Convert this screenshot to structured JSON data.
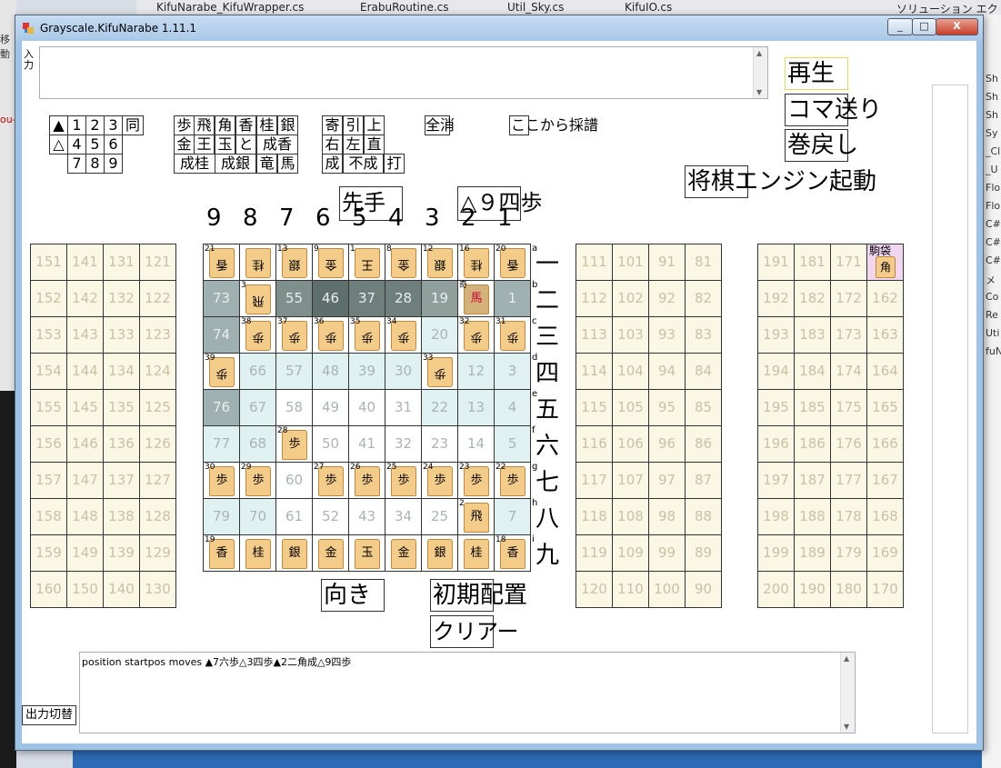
{
  "ide": {
    "tabs": [
      "KifuNarabe_KifuWrapper.cs",
      "ErabuRoutine.cs",
      "Util_Sky.cs",
      "KifuIO.cs",
      "ソリューション エク"
    ],
    "solution_items": [
      "Sh",
      "Sh",
      "Sh",
      "Sy",
      "_Cl",
      "_U",
      "Flo",
      "Flo",
      "C#",
      "C#",
      "C#",
      "メ",
      "Co",
      "Re",
      "Uti",
      "fuN"
    ],
    "left_fragments": [
      "移動",
      "ou-"
    ]
  },
  "window": {
    "title": "Grayscale.KifuNarabe 1.11.1",
    "minimize": "_",
    "maximize": "□",
    "close": "X"
  },
  "input": {
    "label": "入力",
    "value": ""
  },
  "number_buttons": [
    "▲",
    "1",
    "2",
    "3",
    "同",
    "△",
    "4",
    "5",
    "6",
    "7",
    "8",
    "9"
  ],
  "piece_buttons": [
    "歩",
    "飛",
    "角",
    "香",
    "桂",
    "銀",
    "金",
    "王",
    "玉",
    "と",
    "成香",
    "成桂",
    "成銀",
    "竜",
    "馬"
  ],
  "move_buttons": [
    "寄",
    "引",
    "上",
    "右",
    "左",
    "直",
    "成",
    "不成",
    "打"
  ],
  "clear_all": "全消",
  "record_from_here": "ここから採譜",
  "side_button": "先手",
  "last_move_label": "△９四歩",
  "right_buttons": {
    "play": "再生",
    "step_forward": "コマ送り",
    "rewind": "巻戻し",
    "engine": "将棋エンジン起動"
  },
  "column_numbers": [
    "9",
    "8",
    "7",
    "6",
    "5",
    "4",
    "3",
    "2",
    "1"
  ],
  "row_kanji": [
    "一",
    "二",
    "三",
    "四",
    "五",
    "六",
    "七",
    "八",
    "九"
  ],
  "row_letters": [
    "a",
    "b",
    "c",
    "d",
    "e",
    "f",
    "g",
    "h",
    "i"
  ],
  "board": [
    [
      "21",
      "",
      "13",
      "9",
      "1",
      "8",
      "12",
      "16",
      "20"
    ],
    [
      "73",
      "3",
      "55",
      "46",
      "37",
      "28",
      "19",
      "",
      "1"
    ],
    [
      "74",
      "",
      "",
      "",
      "",
      "",
      "20",
      "",
      "31"
    ],
    [
      "",
      "66",
      "57",
      "48",
      "39",
      "30",
      "",
      "12",
      "3"
    ],
    [
      "76",
      "67",
      "58",
      "49",
      "40",
      "31",
      "22",
      "13",
      "4"
    ],
    [
      "77",
      "68",
      "",
      "50",
      "41",
      "32",
      "23",
      "14",
      "5"
    ],
    [
      "",
      "",
      "60",
      "",
      "",
      "",
      "",
      "",
      "22"
    ],
    [
      "79",
      "70",
      "61",
      "52",
      "43",
      "34",
      "25",
      "",
      "7"
    ],
    [
      "19",
      "",
      "",
      "",
      "",
      "",
      "",
      "",
      ""
    ]
  ],
  "pieces": [
    {
      "r": 0,
      "c": 0,
      "t": "香",
      "n": "21",
      "rev": true
    },
    {
      "r": 0,
      "c": 1,
      "t": "桂",
      "n": "",
      "rev": true
    },
    {
      "r": 0,
      "c": 2,
      "t": "銀",
      "n": "13",
      "rev": true
    },
    {
      "r": 0,
      "c": 3,
      "t": "金",
      "n": "9",
      "rev": true
    },
    {
      "r": 0,
      "c": 4,
      "t": "王",
      "n": "1",
      "rev": true
    },
    {
      "r": 0,
      "c": 5,
      "t": "金",
      "n": "8",
      "rev": true
    },
    {
      "r": 0,
      "c": 6,
      "t": "銀",
      "n": "12",
      "rev": true
    },
    {
      "r": 0,
      "c": 7,
      "t": "桂",
      "n": "16",
      "rev": true
    },
    {
      "r": 0,
      "c": 8,
      "t": "香",
      "n": "20",
      "rev": true
    },
    {
      "r": 1,
      "c": 1,
      "t": "飛",
      "n": "3",
      "rev": true
    },
    {
      "r": 1,
      "c": 7,
      "t": "馬",
      "n": "奇",
      "rev": false
    },
    {
      "r": 2,
      "c": 1,
      "t": "歩",
      "n": "38",
      "rev": true
    },
    {
      "r": 2,
      "c": 2,
      "t": "歩",
      "n": "37",
      "rev": true
    },
    {
      "r": 2,
      "c": 3,
      "t": "歩",
      "n": "36",
      "rev": true
    },
    {
      "r": 2,
      "c": 4,
      "t": "歩",
      "n": "35",
      "rev": true
    },
    {
      "r": 2,
      "c": 5,
      "t": "歩",
      "n": "34",
      "rev": true
    },
    {
      "r": 2,
      "c": 7,
      "t": "歩",
      "n": "32",
      "rev": true
    },
    {
      "r": 2,
      "c": 8,
      "t": "歩",
      "n": "31",
      "rev": true
    },
    {
      "r": 3,
      "c": 0,
      "t": "歩",
      "n": "39",
      "rev": true
    },
    {
      "r": 3,
      "c": 6,
      "t": "歩",
      "n": "33",
      "rev": true
    },
    {
      "r": 5,
      "c": 2,
      "t": "歩",
      "n": "28",
      "rev": false
    },
    {
      "r": 6,
      "c": 0,
      "t": "歩",
      "n": "30",
      "rev": false
    },
    {
      "r": 6,
      "c": 1,
      "t": "歩",
      "n": "29",
      "rev": false
    },
    {
      "r": 6,
      "c": 3,
      "t": "歩",
      "n": "27",
      "rev": false
    },
    {
      "r": 6,
      "c": 4,
      "t": "歩",
      "n": "26",
      "rev": false
    },
    {
      "r": 6,
      "c": 5,
      "t": "歩",
      "n": "25",
      "rev": false
    },
    {
      "r": 6,
      "c": 6,
      "t": "歩",
      "n": "24",
      "rev": false
    },
    {
      "r": 6,
      "c": 7,
      "t": "歩",
      "n": "23",
      "rev": false
    },
    {
      "r": 6,
      "c": 8,
      "t": "歩",
      "n": "22",
      "rev": false
    },
    {
      "r": 7,
      "c": 7,
      "t": "飛",
      "n": "2",
      "rev": false
    },
    {
      "r": 8,
      "c": 0,
      "t": "香",
      "n": "19",
      "rev": false
    },
    {
      "r": 8,
      "c": 1,
      "t": "桂",
      "n": "",
      "rev": false
    },
    {
      "r": 8,
      "c": 2,
      "t": "銀",
      "n": "",
      "rev": false
    },
    {
      "r": 8,
      "c": 3,
      "t": "金",
      "n": "",
      "rev": false
    },
    {
      "r": 8,
      "c": 4,
      "t": "玉",
      "n": "",
      "rev": false
    },
    {
      "r": 8,
      "c": 5,
      "t": "金",
      "n": "",
      "rev": false
    },
    {
      "r": 8,
      "c": 6,
      "t": "銀",
      "n": "",
      "rev": false
    },
    {
      "r": 8,
      "c": 7,
      "t": "桂",
      "n": "",
      "rev": false
    },
    {
      "r": 8,
      "c": 8,
      "t": "香",
      "n": "18",
      "rev": false
    }
  ],
  "left_stand": [
    [
      "151",
      "141",
      "131",
      "121"
    ],
    [
      "152",
      "142",
      "132",
      "122"
    ],
    [
      "153",
      "143",
      "133",
      "123"
    ],
    [
      "154",
      "144",
      "134",
      "124"
    ],
    [
      "155",
      "145",
      "135",
      "125"
    ],
    [
      "156",
      "146",
      "136",
      "126"
    ],
    [
      "157",
      "147",
      "137",
      "127"
    ],
    [
      "158",
      "148",
      "138",
      "128"
    ],
    [
      "159",
      "149",
      "139",
      "129"
    ],
    [
      "160",
      "150",
      "140",
      "130"
    ]
  ],
  "right_stand": [
    [
      "111",
      "101",
      "91",
      "81"
    ],
    [
      "112",
      "102",
      "92",
      "82"
    ],
    [
      "113",
      "103",
      "93",
      "83"
    ],
    [
      "114",
      "104",
      "94",
      "84"
    ],
    [
      "115",
      "105",
      "95",
      "85"
    ],
    [
      "116",
      "106",
      "96",
      "86"
    ],
    [
      "117",
      "107",
      "97",
      "87"
    ],
    [
      "118",
      "108",
      "98",
      "88"
    ],
    [
      "119",
      "109",
      "99",
      "89"
    ],
    [
      "120",
      "110",
      "100",
      "90"
    ]
  ],
  "far_stand": [
    [
      "191",
      "181",
      "171",
      ""
    ],
    [
      "192",
      "182",
      "172",
      "162"
    ],
    [
      "193",
      "183",
      "173",
      "163"
    ],
    [
      "194",
      "184",
      "174",
      "164"
    ],
    [
      "195",
      "185",
      "175",
      "165"
    ],
    [
      "196",
      "186",
      "176",
      "166"
    ],
    [
      "197",
      "187",
      "177",
      "167"
    ],
    [
      "198",
      "188",
      "178",
      "168"
    ],
    [
      "199",
      "189",
      "179",
      "169"
    ],
    [
      "200",
      "190",
      "180",
      "170"
    ]
  ],
  "koma_bukuro": "駒袋",
  "koma_bukuro_piece": "角",
  "orientation_button": "向き",
  "initial_setup_button": "初期配置",
  "clear_button": "クリアー",
  "output": {
    "text": "position startpos moves ▲7六歩△3四歩▲2二角成△9四歩",
    "toggle": "出力切替"
  },
  "colors": {
    "window_frame": "#9ec3e6",
    "stand_cell": "#faf7e4",
    "piece": "#f3cc8a"
  }
}
